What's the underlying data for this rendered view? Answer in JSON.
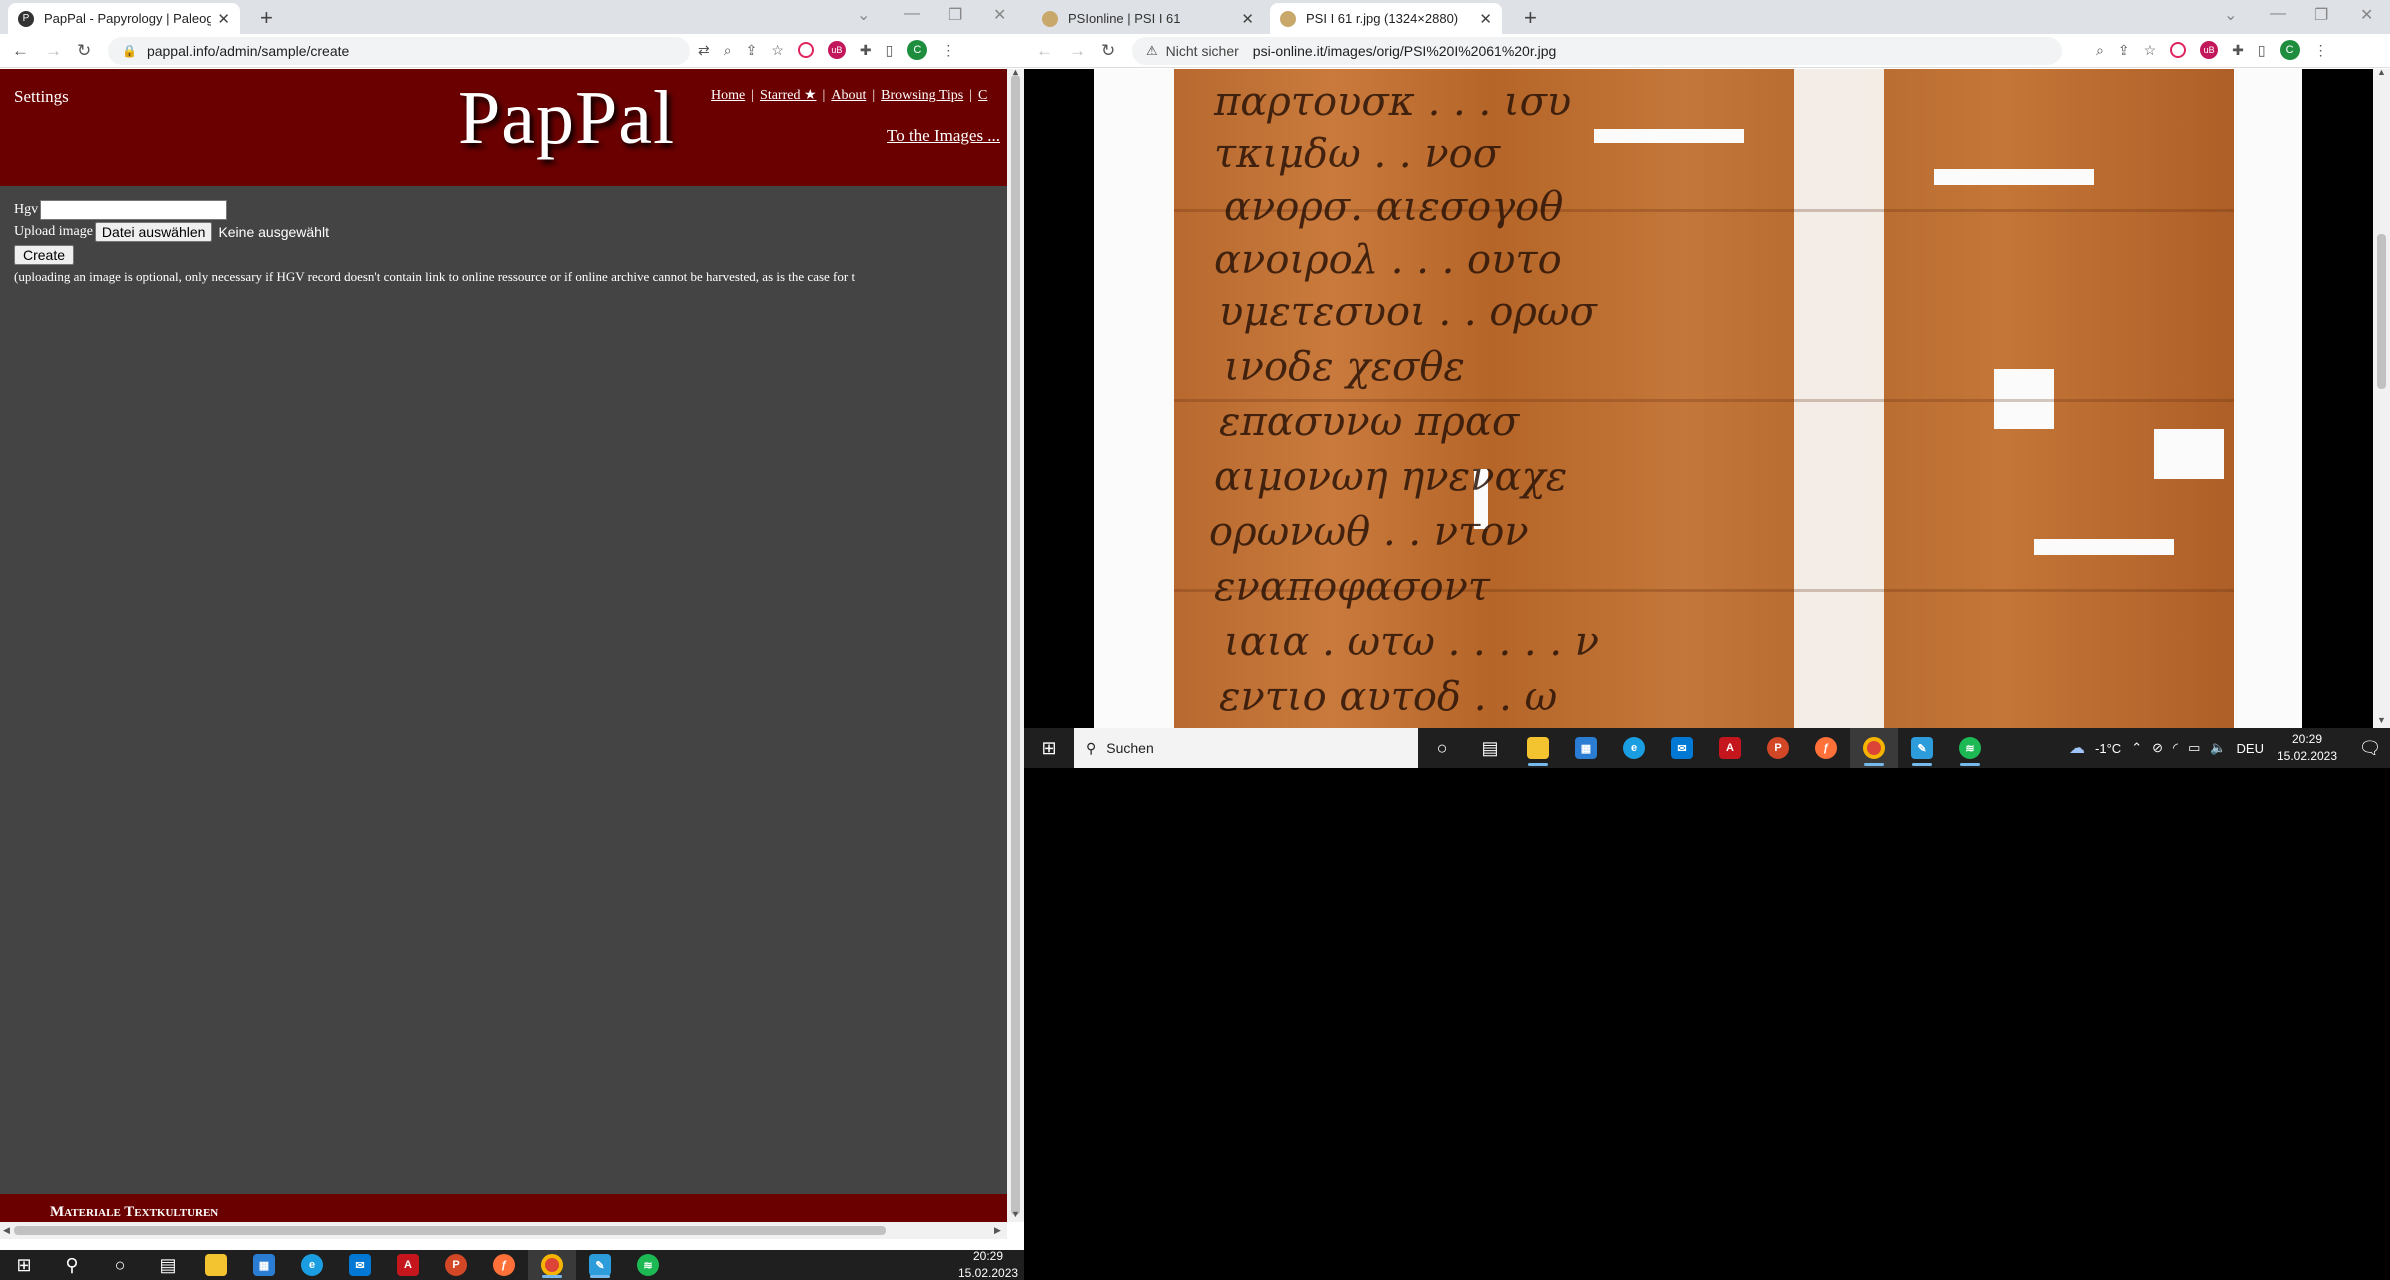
{
  "left_window": {
    "tabs": [
      {
        "label": "PapPal - Papyrology | Paleography",
        "favicon": "P"
      }
    ],
    "url": "pappal.info/admin/sample/create",
    "page": {
      "settings": "Settings",
      "logo": "PapPal",
      "nav": {
        "home": "Home",
        "starred": "Starred ★",
        "about": "About",
        "browsing_tips": "Browsing Tips",
        "cut": "C"
      },
      "to_images": "To the Images ...",
      "form": {
        "hgv_label": "Hgv",
        "hgv_value": "",
        "upload_label": "Upload image",
        "file_button": "Datei auswählen",
        "no_file": "Keine ausgewählt",
        "create": "Create",
        "note": "(uploading an image is optional, only necessary if HGV record doesn't contain link to online ressource or if online archive cannot be harvested, as is the case for t"
      },
      "footer": "Materiale Textkulturen"
    }
  },
  "right_window": {
    "tabs": [
      {
        "label": "PSIonline | PSI I 61"
      },
      {
        "label": "PSI I 61 r.jpg (1324×2880)"
      }
    ],
    "security_label": "Nicht sicher",
    "url": "psi-online.it/images/orig/PSI%20I%2061%20r.jpg",
    "papyrus_lines": [
      "παρτουσκ . . . ισυ",
      "τκιμδω . . νοσ",
      "ανορσ. αιεσογοθ",
      "ανοιρολ . . . ουτο",
      "υμετεσυοι . . ορωσ",
      "ινοδε χεσθε",
      "επασυνω πρασ",
      "αιμονωη ηνεναχε",
      "ορωνωθ . . ντον",
      "εναποφασοντ",
      "ιαια . ωτω . . . . . ν",
      "εντιο αυτοδ . . ω"
    ]
  },
  "taskbar_left": {
    "time": "20:29",
    "date": "15.02.2023"
  },
  "taskbar_right": {
    "search": "Suchen",
    "weather": "-1°C",
    "language": "DEU",
    "time": "20:29",
    "date": "15.02.2023"
  },
  "colors": {
    "site_header": "#6b0000",
    "site_body": "#444444",
    "taskbar": "#1f1f1f"
  }
}
